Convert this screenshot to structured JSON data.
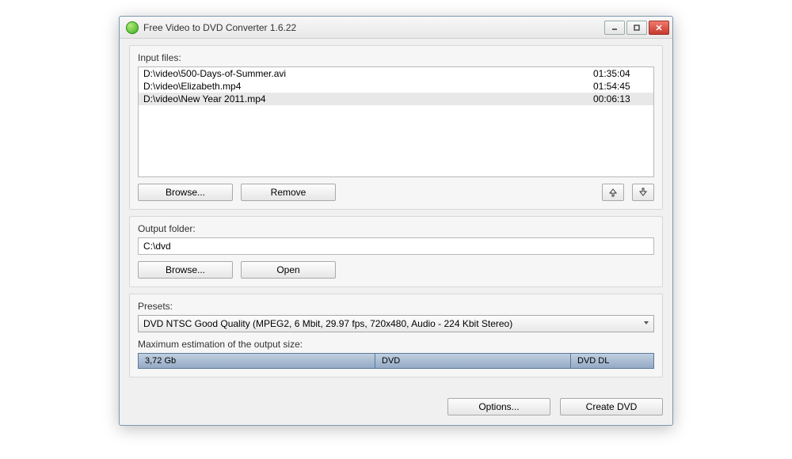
{
  "window": {
    "title": "Free Video to DVD Converter 1.6.22"
  },
  "input": {
    "label": "Input files:",
    "files": [
      {
        "path": "D:\\video\\500-Days-of-Summer.avi",
        "duration": "01:35:04",
        "selected": false
      },
      {
        "path": "D:\\video\\Elizabeth.mp4",
        "duration": "01:54:45",
        "selected": false
      },
      {
        "path": "D:\\video\\New Year 2011.mp4",
        "duration": "00:06:13",
        "selected": true
      }
    ],
    "browse": "Browse...",
    "remove": "Remove"
  },
  "output": {
    "label": "Output folder:",
    "value": "C:\\dvd",
    "browse": "Browse...",
    "open": "Open"
  },
  "presets": {
    "label": "Presets:",
    "selected": "DVD NTSC Good Quality (MPEG2, 6 Mbit, 29.97 fps, 720x480, Audio - 224 Kbit Stereo)",
    "size_label": "Maximum estimation of the output size:",
    "segments": [
      "3,72 Gb",
      "DVD",
      "DVD DL"
    ]
  },
  "footer": {
    "options": "Options...",
    "create": "Create DVD"
  }
}
